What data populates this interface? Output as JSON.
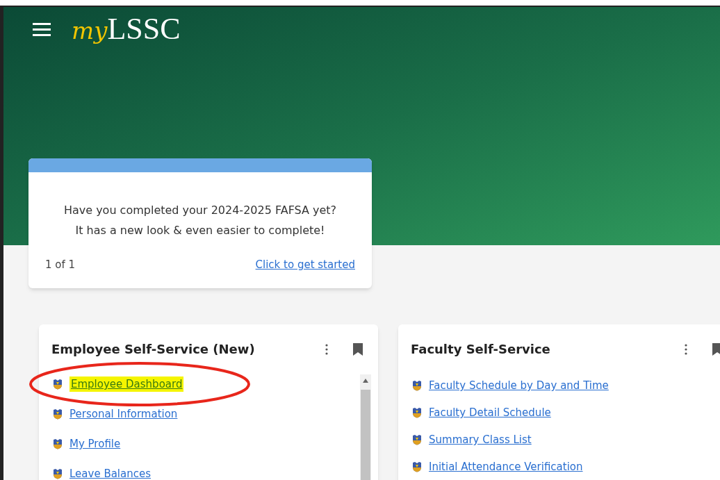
{
  "header": {
    "logo_script": "my",
    "logo_text": "LSSC"
  },
  "announcement": {
    "text": "Have you completed your 2024-2025 FAFSA yet?\nIt has a new look & even easier to complete!",
    "pager": "1 of 1",
    "link": "Click to get started"
  },
  "cards": [
    {
      "title": "Employee Self-Service (New)",
      "scrollable": true,
      "links": [
        {
          "label": "Employee Dashboard",
          "highlighted": true,
          "circled": true
        },
        {
          "label": "Personal Information",
          "highlighted": false,
          "circled": false
        },
        {
          "label": "My Profile",
          "highlighted": false,
          "circled": false
        },
        {
          "label": "Leave Balances",
          "highlighted": false,
          "circled": false
        }
      ]
    },
    {
      "title": "Faculty Self-Service",
      "links": [
        {
          "label": "Faculty Schedule by Day and Time",
          "highlighted": false,
          "circled": false
        },
        {
          "label": "Faculty Detail Schedule",
          "highlighted": false,
          "circled": false
        },
        {
          "label": "Summary Class List",
          "highlighted": false,
          "circled": false
        },
        {
          "label": "Initial Attendance Verification",
          "highlighted": false,
          "circled": false
        }
      ]
    }
  ]
}
